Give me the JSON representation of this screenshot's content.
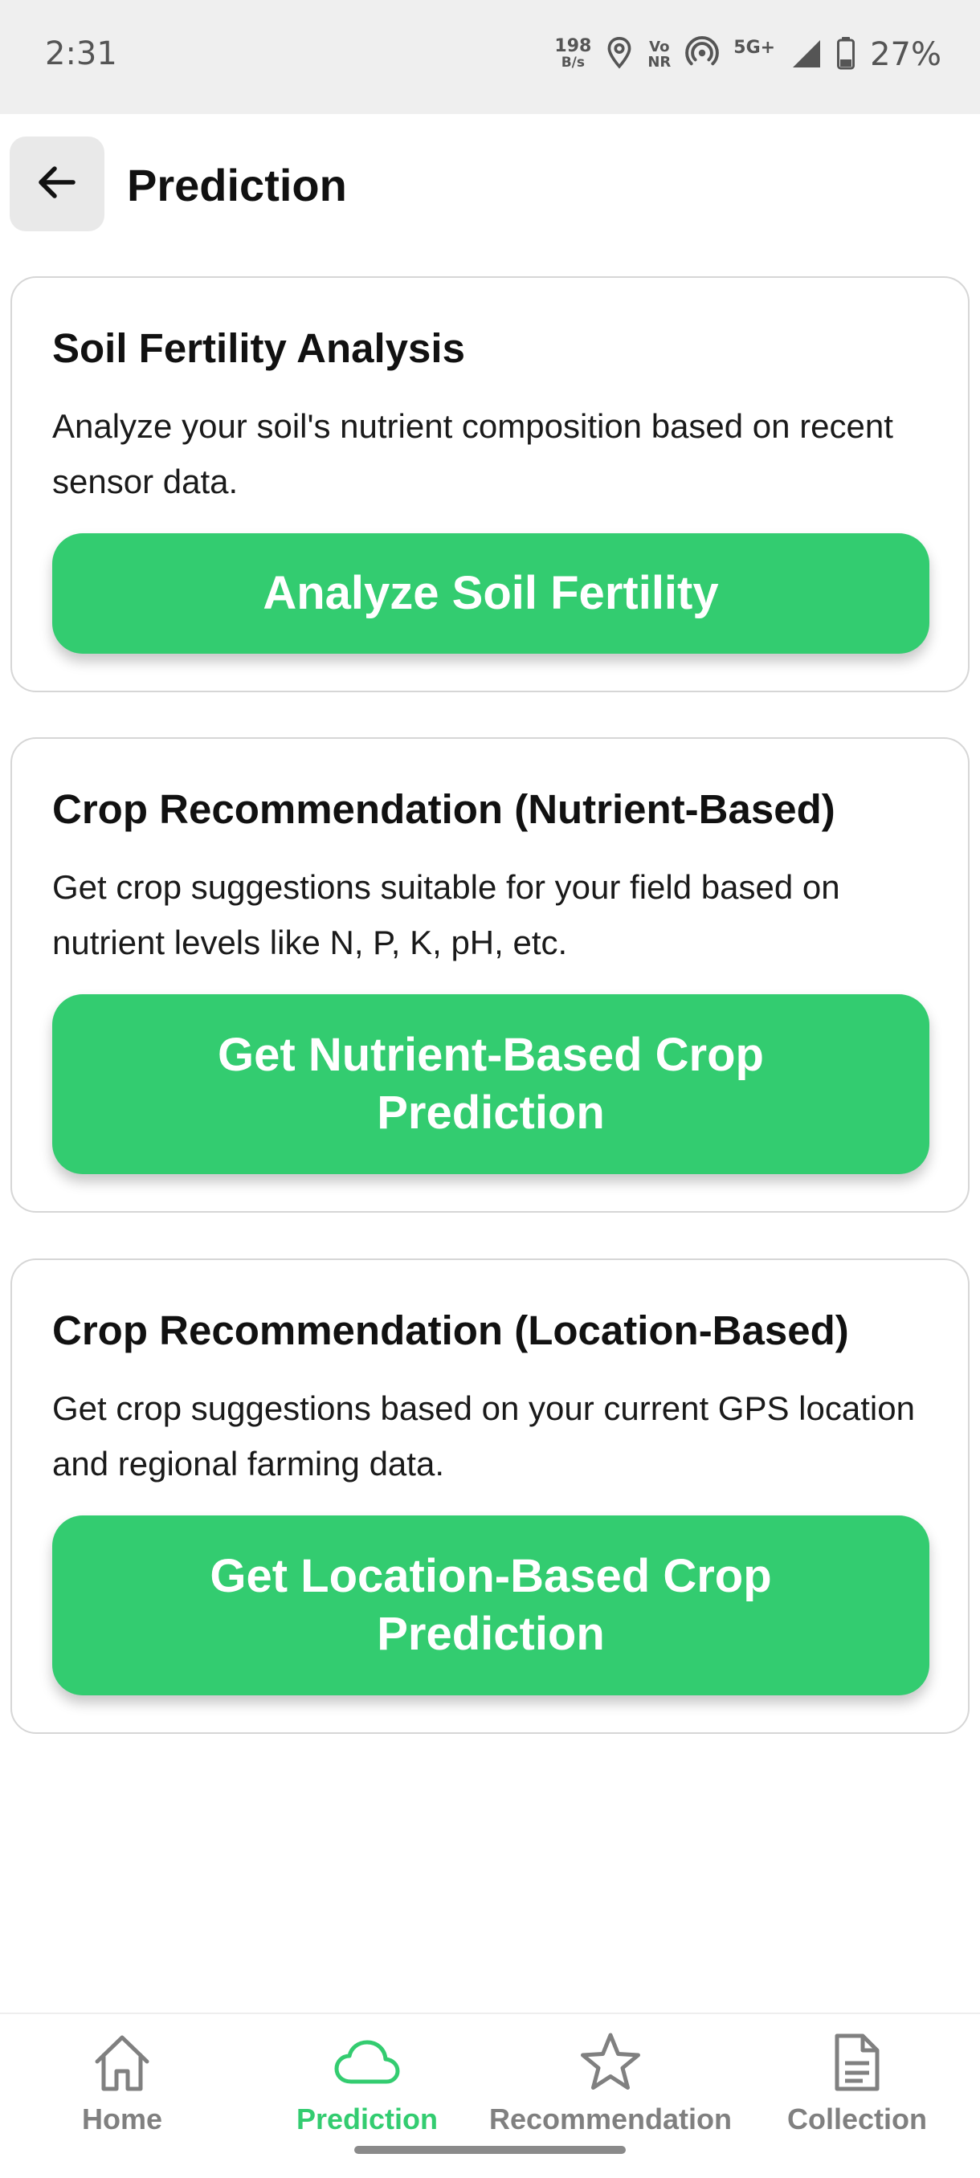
{
  "status_bar": {
    "time": "2:31",
    "speed_value": "198",
    "speed_unit": "B/s",
    "volte_top": "Vo",
    "volte_bottom": "NR",
    "network": "5G+",
    "battery": "27%"
  },
  "header": {
    "title": "Prediction",
    "back_icon": "arrow-left-icon"
  },
  "cards": [
    {
      "title": "Soil Fertility Analysis",
      "description": "Analyze your soil's nutrient composition based on recent sensor data.",
      "button_label": "Analyze Soil Fertility"
    },
    {
      "title": "Crop Recommendation (Nutrient-Based)",
      "description": "Get crop suggestions suitable for your field based on nutrient levels like N, P, K, pH, etc.",
      "button_label": "Get Nutrient-Based Crop Prediction"
    },
    {
      "title": "Crop Recommendation (Location-Based)",
      "description": "Get crop suggestions based on your current GPS location and regional farming data.",
      "button_label": "Get Location-Based Crop Prediction"
    }
  ],
  "bottom_nav": {
    "items": [
      {
        "label": "Home",
        "icon": "home-icon",
        "active": false
      },
      {
        "label": "Prediction",
        "icon": "cloud-icon",
        "active": true
      },
      {
        "label": "Recommendation",
        "icon": "star-icon",
        "active": false
      },
      {
        "label": "Collection",
        "icon": "document-icon",
        "active": false
      }
    ]
  },
  "colors": {
    "accent": "#33cc70",
    "inactive_nav": "#808080",
    "status_bar_bg": "#efefef"
  }
}
